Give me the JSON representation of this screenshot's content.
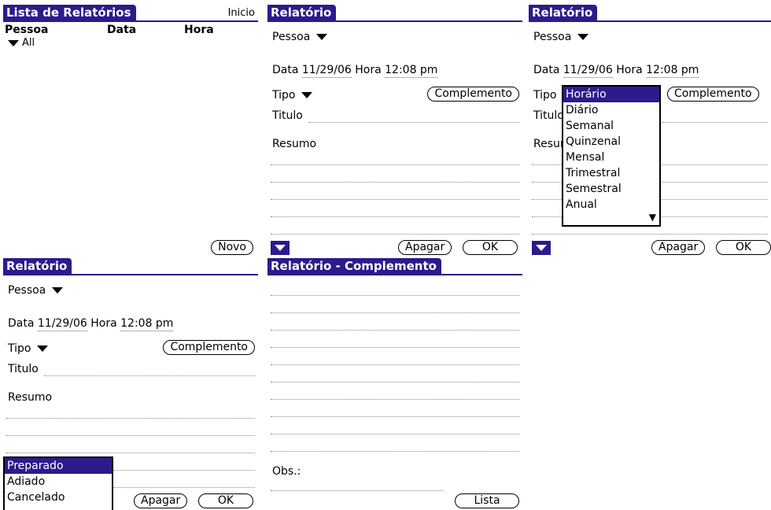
{
  "s1": {
    "title": "Lista de Relatórios",
    "nav": "Inicio",
    "col_pessoa": "Pessoa",
    "col_data": "Data",
    "col_hora": "Hora",
    "filter": "All",
    "new_button": "Novo"
  },
  "form": {
    "title": "Relatório",
    "pessoa": "Pessoa",
    "data_label": "Data",
    "data_value": "11/29/06",
    "hora_label": "Hora",
    "hora_value": "12:08 pm",
    "tipo_label": "Tipo",
    "complemento_button": "Complemento",
    "titulo_label": "Titulo",
    "resumo_label": "Resumo",
    "apagar_button": "Apagar",
    "ok_button": "OK"
  },
  "tipo_popup": {
    "items": [
      "Horário",
      "Diário",
      "Semanal",
      "Quinzenal",
      "Mensal",
      "Trimestral",
      "Semestral",
      "Anual"
    ],
    "selected": "Horário"
  },
  "status_popup": {
    "items": [
      "Preparado",
      "Adiado",
      "Cancelado"
    ],
    "selected": "Preparado"
  },
  "s5": {
    "title": "Relatório - Complemento",
    "obs_label": "Obs.:",
    "lista_button": "Lista"
  },
  "colors": {
    "accent": "#2b1b8c"
  }
}
